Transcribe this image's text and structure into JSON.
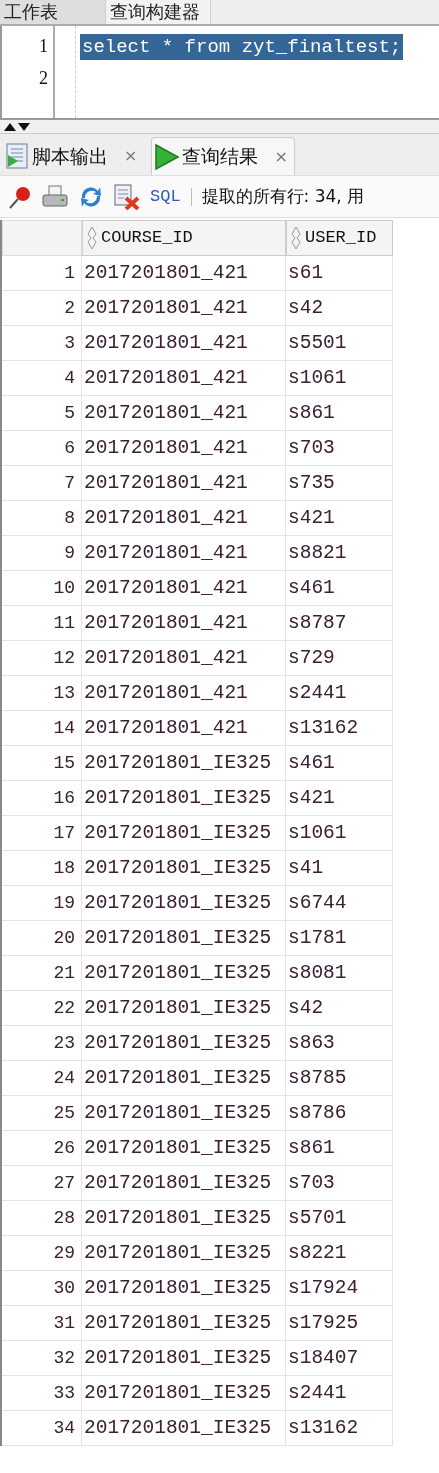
{
  "top_tabs": [
    {
      "label": "工作表",
      "selected": true
    },
    {
      "label": "查询构建器",
      "selected": false
    }
  ],
  "editor": {
    "lines": [
      {
        "number": "1",
        "code": "select * from zyt_finaltest;",
        "selected": true
      },
      {
        "number": "2"
      }
    ]
  },
  "result_tabs": [
    {
      "label": "脚本输出",
      "close": "×",
      "selected": false
    },
    {
      "label": "查询结果",
      "close": "×",
      "selected": true
    }
  ],
  "toolbar": {
    "sql_button": "SQL",
    "status": "提取的所有行: 34, 用"
  },
  "table": {
    "columns": [
      "COURSE_ID",
      "USER_ID"
    ],
    "rows": [
      {
        "number": "1",
        "course_id": "2017201801_421",
        "user_id": "s61"
      },
      {
        "number": "2",
        "course_id": "2017201801_421",
        "user_id": "s42"
      },
      {
        "number": "3",
        "course_id": "2017201801_421",
        "user_id": "s5501"
      },
      {
        "number": "4",
        "course_id": "2017201801_421",
        "user_id": "s1061"
      },
      {
        "number": "5",
        "course_id": "2017201801_421",
        "user_id": "s861"
      },
      {
        "number": "6",
        "course_id": "2017201801_421",
        "user_id": "s703"
      },
      {
        "number": "7",
        "course_id": "2017201801_421",
        "user_id": "s735"
      },
      {
        "number": "8",
        "course_id": "2017201801_421",
        "user_id": "s421"
      },
      {
        "number": "9",
        "course_id": "2017201801_421",
        "user_id": "s8821"
      },
      {
        "number": "10",
        "course_id": "2017201801_421",
        "user_id": "s461"
      },
      {
        "number": "11",
        "course_id": "2017201801_421",
        "user_id": "s8787"
      },
      {
        "number": "12",
        "course_id": "2017201801_421",
        "user_id": "s729"
      },
      {
        "number": "13",
        "course_id": "2017201801_421",
        "user_id": "s2441"
      },
      {
        "number": "14",
        "course_id": "2017201801_421",
        "user_id": "s13162"
      },
      {
        "number": "15",
        "course_id": "2017201801_IE325",
        "user_id": "s461"
      },
      {
        "number": "16",
        "course_id": "2017201801_IE325",
        "user_id": "s421"
      },
      {
        "number": "17",
        "course_id": "2017201801_IE325",
        "user_id": "s1061"
      },
      {
        "number": "18",
        "course_id": "2017201801_IE325",
        "user_id": "s41"
      },
      {
        "number": "19",
        "course_id": "2017201801_IE325",
        "user_id": "s6744"
      },
      {
        "number": "20",
        "course_id": "2017201801_IE325",
        "user_id": "s1781"
      },
      {
        "number": "21",
        "course_id": "2017201801_IE325",
        "user_id": "s8081"
      },
      {
        "number": "22",
        "course_id": "2017201801_IE325",
        "user_id": "s42"
      },
      {
        "number": "23",
        "course_id": "2017201801_IE325",
        "user_id": "s863"
      },
      {
        "number": "24",
        "course_id": "2017201801_IE325",
        "user_id": "s8785"
      },
      {
        "number": "25",
        "course_id": "2017201801_IE325",
        "user_id": "s8786"
      },
      {
        "number": "26",
        "course_id": "2017201801_IE325",
        "user_id": "s861"
      },
      {
        "number": "27",
        "course_id": "2017201801_IE325",
        "user_id": "s703"
      },
      {
        "number": "28",
        "course_id": "2017201801_IE325",
        "user_id": "s5701"
      },
      {
        "number": "29",
        "course_id": "2017201801_IE325",
        "user_id": "s8221"
      },
      {
        "number": "30",
        "course_id": "2017201801_IE325",
        "user_id": "s17924"
      },
      {
        "number": "31",
        "course_id": "2017201801_IE325",
        "user_id": "s17925"
      },
      {
        "number": "32",
        "course_id": "2017201801_IE325",
        "user_id": "s18407"
      },
      {
        "number": "33",
        "course_id": "2017201801_IE325",
        "user_id": "s2441"
      },
      {
        "number": "34",
        "course_id": "2017201801_IE325",
        "user_id": "s13162"
      }
    ]
  }
}
